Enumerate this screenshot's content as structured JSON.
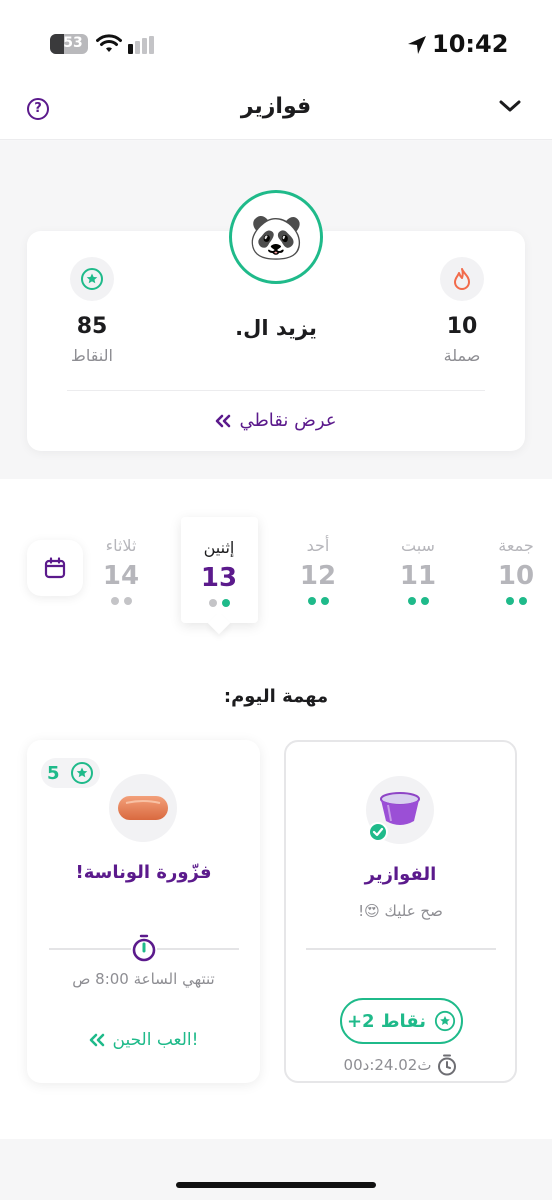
{
  "status_bar": {
    "time": "10:42",
    "battery": "53"
  },
  "header": {
    "title": "فوازير",
    "help_glyph": "?"
  },
  "profile": {
    "name": "يزيد ال.",
    "avatar_emoji": "🐼",
    "points": {
      "value": "85",
      "label": "النقاط"
    },
    "streak": {
      "value": "10",
      "label": "صملة"
    },
    "link_label": "عرض نقاطي"
  },
  "calendar": {
    "days": [
      {
        "name": "جمعة",
        "num": "10"
      },
      {
        "name": "سبت",
        "num": "11"
      },
      {
        "name": "أحد",
        "num": "12"
      },
      {
        "name": "إثنين",
        "num": "13"
      },
      {
        "name": "ثلاثاء",
        "num": "14"
      }
    ]
  },
  "tasks": {
    "title": "مهمة اليوم:",
    "left": {
      "badge": "5",
      "title": "فزّورة الوناسة!",
      "ends_label": "تنتهي",
      "ends_time": "الساعة 8:00 ص",
      "play_label": "العب الحين!"
    },
    "right": {
      "title": "الفوازير",
      "subtitle": "صح عليك 😍!",
      "points_label": "+2 نقاط",
      "time_left": "ث24.02:د00"
    }
  },
  "colors": {
    "brand_purple": "#5b1a8c",
    "accent_green": "#1fba8a",
    "fire": "#f26b4b"
  }
}
